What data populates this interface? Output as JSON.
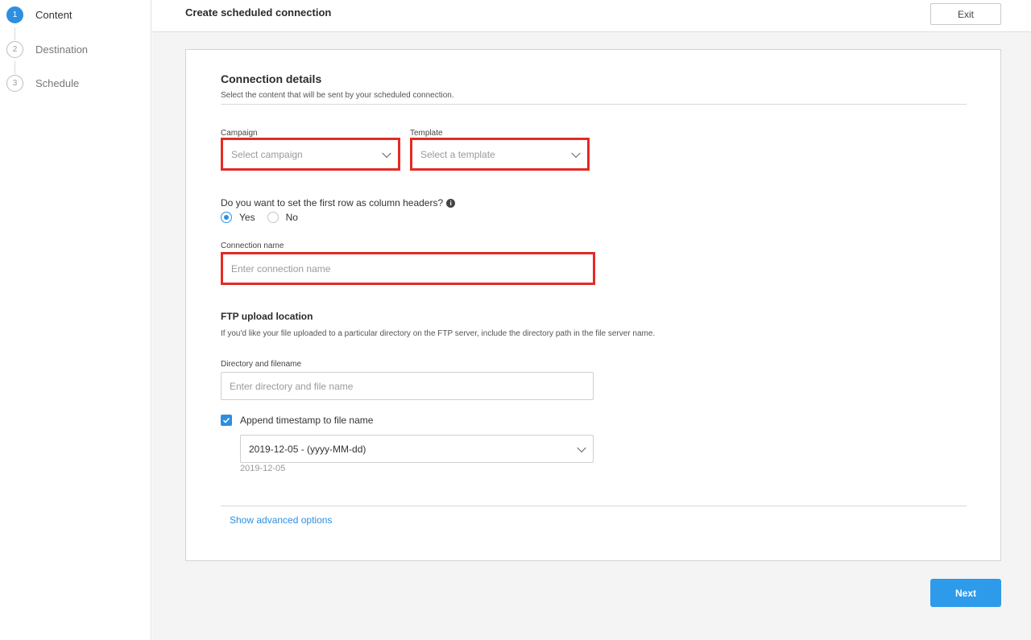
{
  "sidebar": {
    "steps": [
      {
        "number": "1",
        "label": "Content"
      },
      {
        "number": "2",
        "label": "Destination"
      },
      {
        "number": "3",
        "label": "Schedule"
      }
    ]
  },
  "header": {
    "title": "Create scheduled connection",
    "exit_label": "Exit"
  },
  "connection_details": {
    "title": "Connection details",
    "description": "Select the content that will be sent by your scheduled connection.",
    "campaign": {
      "label": "Campaign",
      "placeholder": "Select campaign"
    },
    "template": {
      "label": "Template",
      "placeholder": "Select a template"
    },
    "headers_question": "Do you want to set the first row as column headers?",
    "radio_yes": "Yes",
    "radio_no": "No",
    "radio_selected": "Yes",
    "connection_name": {
      "label": "Connection name",
      "placeholder": "Enter connection name"
    }
  },
  "ftp": {
    "title": "FTP upload location",
    "description": "If you'd like your file uploaded to a particular directory on the FTP server, include the directory path in the file server name.",
    "directory": {
      "label": "Directory and filename",
      "placeholder": "Enter directory and file name"
    },
    "append_timestamp_label": "Append timestamp to file name",
    "append_timestamp_checked": true,
    "timestamp_format_value": "2019-12-05 - (yyyy-MM-dd)",
    "timestamp_preview": "2019-12-05"
  },
  "advanced_link": "Show advanced options",
  "next_label": "Next",
  "colors": {
    "accent": "#2d8fe0",
    "highlight": "#e32b24"
  },
  "icons": {
    "info": "info-icon",
    "chevron": "chevron-down-icon",
    "check": "checkmark-icon"
  }
}
